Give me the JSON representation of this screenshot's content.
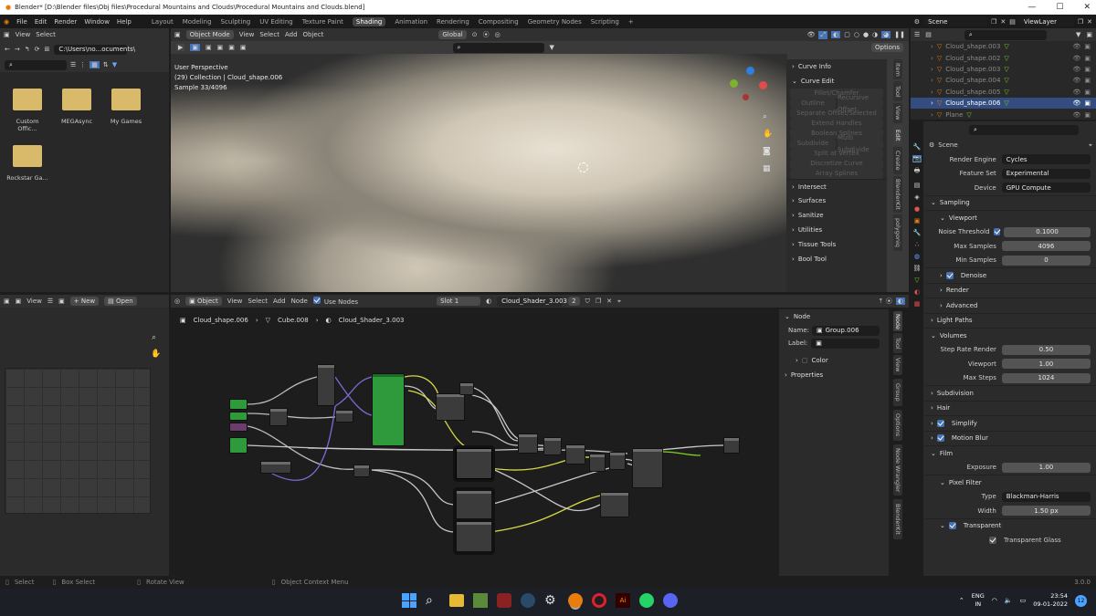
{
  "titlebar": {
    "title": "Blender* [D:\\Blender files\\Obj files\\Procedural Mountains and Clouds\\Procedural Mountains and Clouds.blend]"
  },
  "menubar": {
    "menus": [
      "File",
      "Edit",
      "Render",
      "Window",
      "Help"
    ],
    "workspaces": [
      "Layout",
      "Modeling",
      "Sculpting",
      "UV Editing",
      "Texture Paint",
      "Shading",
      "Animation",
      "Rendering",
      "Compositing",
      "Geometry Nodes",
      "Scripting"
    ],
    "active_workspace": "Shading",
    "scene": "Scene",
    "view_layer": "ViewLayer"
  },
  "filebrowser": {
    "menus": [
      "View",
      "Select"
    ],
    "path": "C:\\Users\\no...ocuments\\",
    "folders": [
      "Custom Offic...",
      "MEGAsync",
      "My Games",
      "Rockstar Ga..."
    ]
  },
  "viewport": {
    "mode": "Object Mode",
    "menus": [
      "View",
      "Select",
      "Add",
      "Object"
    ],
    "transform": "Global",
    "options_label": "Options",
    "overlay_lines": [
      "User Perspective",
      "(29) Collection | Cloud_shape.006",
      "Sample 33/4096"
    ],
    "tool_panel": {
      "headers": [
        "Curve Info",
        "Curve Edit"
      ],
      "buttons": [
        "Fillet/Chamfer",
        "Outline",
        "Recursive Offset",
        "Separate Offset/Selected",
        "Extend Handles",
        "Boolean Splines",
        "Subdivide",
        "Multi Subdivide",
        "Split at Vertex",
        "Discretize Curve",
        "Array Splines"
      ],
      "sections": [
        "Intersect",
        "Surfaces",
        "Sanitize",
        "Utilities",
        "Tissue Tools",
        "Bool Tool"
      ]
    },
    "vtabs": [
      "Item",
      "Tool",
      "View",
      "Edit",
      "Create",
      "BlenderKit",
      "polygoniq"
    ]
  },
  "image_editor": {
    "menus": [
      "View"
    ],
    "new_label": "New",
    "open_label": "Open"
  },
  "node_editor": {
    "type": "Object",
    "menus": [
      "View",
      "Select",
      "Add",
      "Node"
    ],
    "use_nodes": "Use Nodes",
    "slot": "Slot 1",
    "material": "Cloud_Shader_3.003",
    "users": "2",
    "breadcrumb": [
      "Cloud_shape.006",
      "Cube.008",
      "Cloud_Shader_3.003"
    ],
    "side": {
      "node_label": "Node",
      "name_label": "Name:",
      "name_value": "Group.006",
      "label_label": "Label:",
      "color_label": "Color",
      "properties_label": "Properties"
    },
    "vtabs": [
      "Node",
      "Tool",
      "View",
      "Group",
      "Options",
      "Node Wrangler",
      "BlenderKit"
    ]
  },
  "outliner": {
    "items": [
      "Cloud_shape.003",
      "Cloud_shape.002",
      "Cloud_shape.003",
      "Cloud_shape.004",
      "Cloud_shape.005",
      "Cloud_shape.006",
      "Plane"
    ],
    "selected_index": 5
  },
  "properties": {
    "scene_label": "Scene",
    "render_engine_label": "Render Engine",
    "render_engine": "Cycles",
    "feature_set_label": "Feature Set",
    "feature_set": "Experimental",
    "device_label": "Device",
    "device": "GPU Compute",
    "sampling": "Sampling",
    "viewport": "Viewport",
    "noise_threshold_label": "Noise Threshold",
    "noise_threshold": "0.1000",
    "max_samples_label": "Max Samples",
    "max_samples": "4096",
    "min_samples_label": "Min Samples",
    "min_samples": "0",
    "denoise": "Denoise",
    "render": "Render",
    "advanced": "Advanced",
    "light_paths": "Light Paths",
    "volumes": "Volumes",
    "step_rate_render_label": "Step Rate Render",
    "step_rate_render": "0.50",
    "viewport_label": "Viewport",
    "viewport_value": "1.00",
    "max_steps_label": "Max Steps",
    "max_steps": "1024",
    "subdivision": "Subdivision",
    "hair": "Hair",
    "simplify": "Simplify",
    "motion_blur": "Motion Blur",
    "film": "Film",
    "exposure_label": "Exposure",
    "exposure": "1.00",
    "pixel_filter": "Pixel Filter",
    "type_label": "Type",
    "type_value": "Blackman-Harris",
    "width_label": "Width",
    "width_value": "1.50 px",
    "transparent": "Transparent",
    "transparent_glass": "Transparent Glass"
  },
  "statusbar": {
    "select": "Select",
    "box_select": "Box Select",
    "rotate_view": "Rotate View",
    "context_menu": "Object Context Menu",
    "version": "3.0.0"
  },
  "taskbar": {
    "lang1": "ENG",
    "lang2": "IN",
    "time": "23:54",
    "date": "09-01-2022",
    "badge": "12"
  },
  "colors": {
    "accent": "#4772b3",
    "node_green": "#2f9a3b",
    "taskbar": "#1c1f26"
  }
}
